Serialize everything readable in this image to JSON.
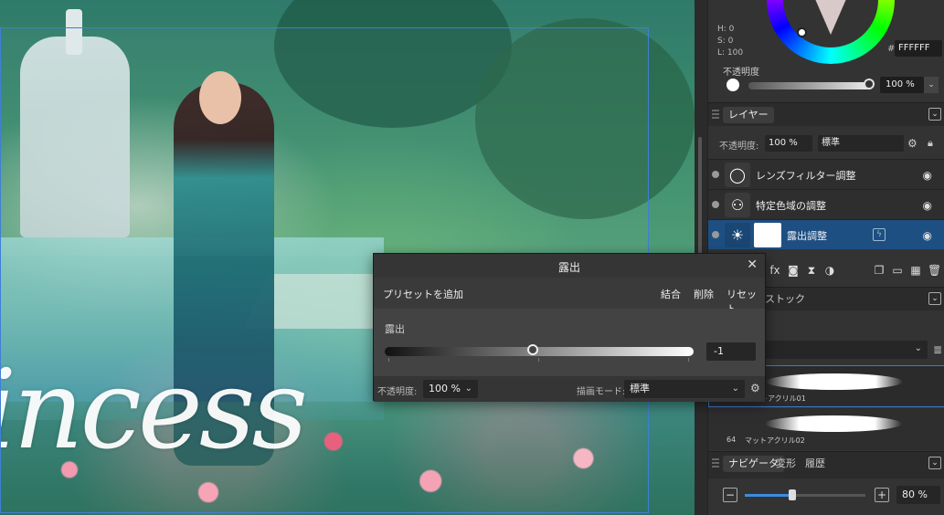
{
  "canvas": {
    "overlay_text": "incess"
  },
  "color_panel": {
    "hsl": [
      "H: 0",
      "S: 0",
      "L: 100"
    ],
    "hex_label": "#:",
    "hex_value": "FFFFFF",
    "opacity_label": "不透明度",
    "opacity_value": "100 %"
  },
  "layers_panel": {
    "tab": "レイヤー",
    "opacity_label": "不透明度:",
    "opacity_value": "100 %",
    "blend_mode": "標準",
    "layers": [
      {
        "name": "レンズフィルター調整",
        "selected": false
      },
      {
        "name": "特定色域の調整",
        "selected": false
      },
      {
        "name": "露出調整",
        "selected": true
      }
    ]
  },
  "brushes_panel": {
    "tab_partial": "ストック",
    "brushes": [
      {
        "num": "",
        "name": "マットアクリル01",
        "selected": true
      },
      {
        "num": "64",
        "name": "マットアクリル02",
        "selected": false
      }
    ]
  },
  "navigator_panel": {
    "tabs": [
      "ナビゲータ",
      "変形",
      "履歴"
    ],
    "zoom_value": "80 %",
    "zoom_minus": "−",
    "zoom_plus": "+"
  },
  "dialog": {
    "title": "露出",
    "close": "✕",
    "add_preset": "プリセットを追加",
    "merge": "結合",
    "delete": "削除",
    "reset": "リセット",
    "exposure_label": "露出",
    "exposure_value": "-1",
    "opacity_label": "不透明度:",
    "opacity_value": "100 %",
    "blend_label": "描画モード:",
    "blend_value": "標準"
  },
  "colors": {
    "accent": "#1e4f82",
    "selection_frame": "#3f7fd6"
  }
}
